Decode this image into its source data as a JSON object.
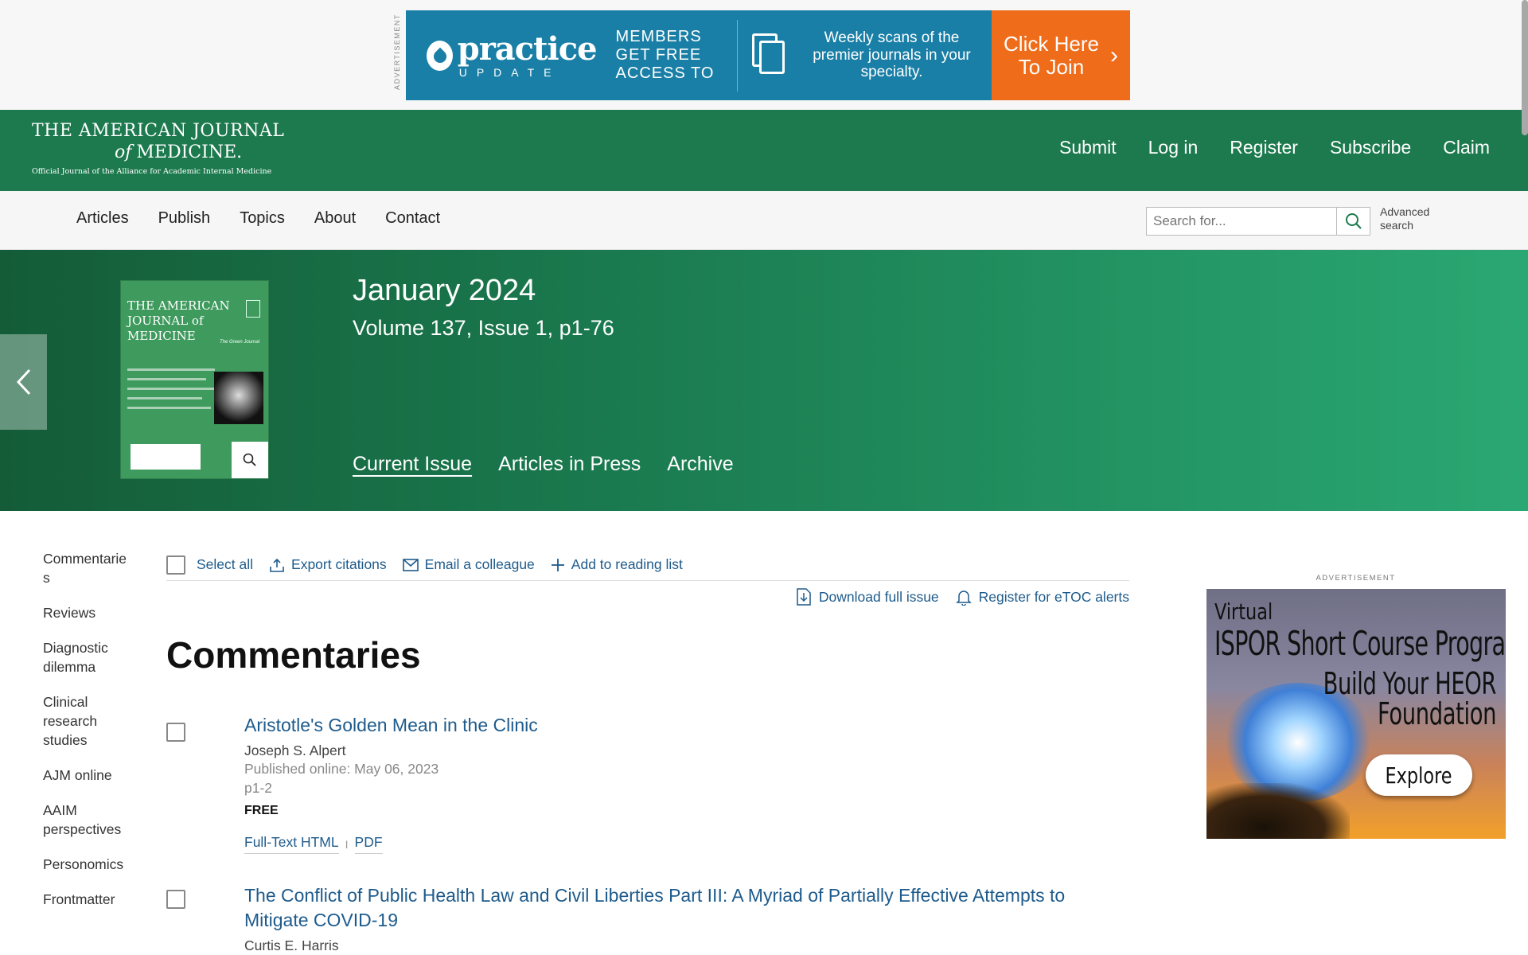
{
  "top_ad": {
    "label": "ADVERTISEMENT",
    "logo_word": "practice",
    "logo_sub": "UPDATE",
    "members_line": "MEMBERS GET FREE ACCESS TO",
    "weekly_text": "Weekly scans of the premier journals in your specialty.",
    "cta_line1": "Click Here",
    "cta_line2": "To Join",
    "colors": {
      "banner": "#1a7fa6",
      "cta": "#ef6c1a"
    }
  },
  "header": {
    "logo_line1": "THE AMERICAN JOURNAL",
    "logo_of": "of",
    "logo_line2": "MEDICINE.",
    "logo_tagline": "Official Journal of the Alliance for Academic Internal Medicine",
    "nav": [
      "Submit",
      "Log in",
      "Register",
      "Subscribe",
      "Claim"
    ],
    "color": "#1d7a4e"
  },
  "subnav": {
    "links": [
      "Articles",
      "Publish",
      "Topics",
      "About",
      "Contact"
    ],
    "search_placeholder": "Search for...",
    "advanced_search_line1": "Advanced",
    "advanced_search_line2": "search"
  },
  "issue": {
    "title": "January 2024",
    "volume": "Volume 137, Issue 1, p1-76",
    "cover_title_1": "THE AMERICAN",
    "cover_title_2": "JOURNAL of",
    "cover_title_3": "MEDICINE",
    "cover_subtitle": "The Green Journal",
    "tabs": [
      "Current Issue",
      "Articles in Press",
      "Archive"
    ],
    "active_tab": "Current Issue"
  },
  "section_nav": [
    "Commentaries",
    "Reviews",
    "Diagnostic dilemma",
    "Clinical research studies",
    "AJM online",
    "AAIM perspectives",
    "Personomics",
    "Frontmatter"
  ],
  "toolbar": {
    "select_all": "Select all",
    "export": "Export citations",
    "email": "Email a colleague",
    "reading_list": "Add to reading list",
    "download_issue": "Download full issue",
    "etoc": "Register for eTOC alerts"
  },
  "section_heading": "Commentaries",
  "articles": [
    {
      "title": "Aristotle's Golden Mean in the Clinic",
      "author": "Joseph S. Alpert",
      "published": "Published online: May 06, 2023",
      "pages": "p1-2",
      "access": "FREE",
      "link_html": "Full-Text HTML",
      "link_sep": "I",
      "link_pdf": "PDF"
    },
    {
      "title": "The Conflict of Public Health Law and Civil Liberties Part III: A Myriad of Partially Effective Attempts to Mitigate COVID-19",
      "author": "Curtis E. Harris"
    }
  ],
  "side_ad": {
    "label": "ADVERTISEMENT",
    "line_virtual": "Virtual",
    "line_program": "ISPOR Short Course Program",
    "line_build1": "Build Your HEOR",
    "line_build2": "Foundation",
    "button": "Explore"
  }
}
